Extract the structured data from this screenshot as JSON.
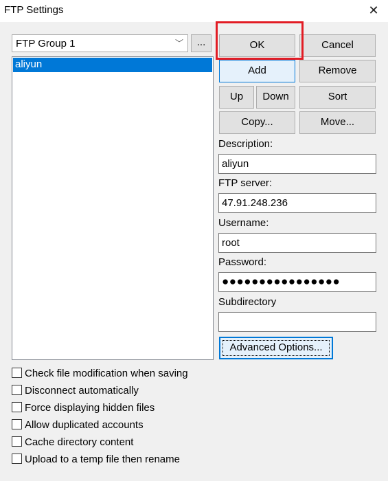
{
  "window": {
    "title": "FTP Settings"
  },
  "group_select": {
    "value": "FTP Group 1",
    "ellipsis_label": "..."
  },
  "servers": [
    {
      "label": "aliyun",
      "selected": true
    }
  ],
  "buttons": {
    "ok": "OK",
    "cancel": "Cancel",
    "add": "Add",
    "remove": "Remove",
    "up": "Up",
    "down": "Down",
    "sort": "Sort",
    "copy": "Copy...",
    "move": "Move...",
    "advanced": "Advanced Options..."
  },
  "fields": {
    "description": {
      "label": "Description:",
      "value": "aliyun"
    },
    "ftp_server": {
      "label": "FTP server:",
      "value": "47.91.248.236"
    },
    "username": {
      "label": "Username:",
      "value": "root"
    },
    "password": {
      "label": "Password:",
      "value": "●●●●●●●●●●●●●●●●"
    },
    "subdirectory": {
      "label": "Subdirectory",
      "value": ""
    }
  },
  "options": [
    {
      "label": "Check file modification when saving",
      "checked": false
    },
    {
      "label": "Disconnect automatically",
      "checked": false
    },
    {
      "label": "Force displaying hidden files",
      "checked": false
    },
    {
      "label": "Allow duplicated accounts",
      "checked": false
    },
    {
      "label": "Cache directory content",
      "checked": false
    },
    {
      "label": "Upload to a temp file then rename",
      "checked": false
    }
  ],
  "colors": {
    "selection": "#0078d7",
    "highlight_box": "#e21c24",
    "background": "#f0f0f0"
  }
}
